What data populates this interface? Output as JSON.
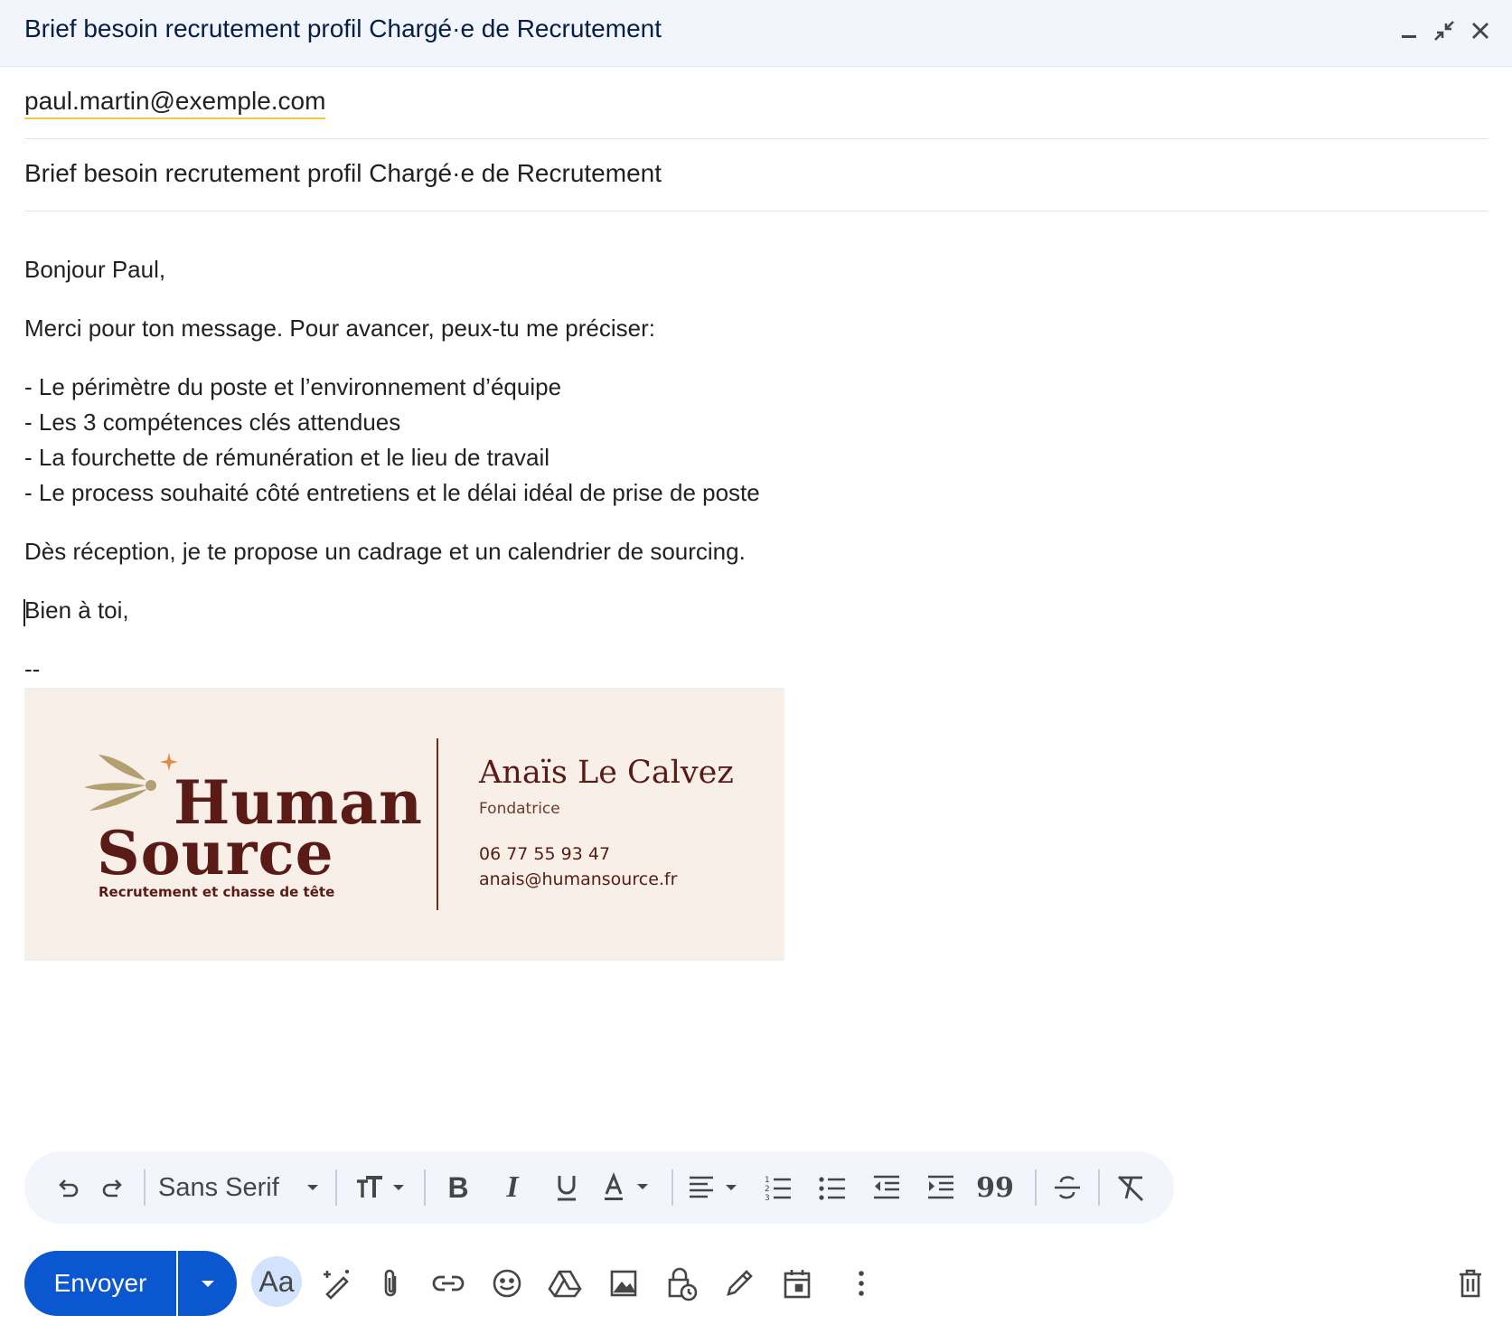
{
  "window": {
    "title": "Brief besoin recrutement profil Chargé·e de Recrutement",
    "icons": [
      "minimize-icon",
      "exit-fullscreen-icon",
      "close-icon"
    ]
  },
  "compose": {
    "to": "paul.martin@exemple.com",
    "subject": "Brief besoin recrutement profil Chargé·e de Recrutement",
    "body": {
      "greeting": "Bonjour Paul,",
      "intro": "Merci pour ton message. Pour avancer, peux-tu me préciser:",
      "bullets": [
        "- Le périmètre du poste et l’environnement d’équipe",
        "- Les 3 compétences clés attendues",
        "- La fourchette de rémunération et le lieu de travail",
        "- Le process souhaité côté entretiens et le délai idéal de prise de poste"
      ],
      "closing_line": "Dès réception, je te propose un cadrage et un calendrier de sourcing.",
      "signoff": "Bien à toi,",
      "sig_separator": "--"
    },
    "signature": {
      "logo_line1": "Human",
      "logo_line2": "Source",
      "tagline": "Recrutement et chasse de tête",
      "name": "Anaïs Le Calvez",
      "role": "Fondatrice",
      "phone": "06 77 55 93 47",
      "email": "anais@humansource.fr"
    }
  },
  "format_toolbar": {
    "font": "Sans Serif",
    "icons": [
      "undo-icon",
      "redo-icon",
      "font-dropdown",
      "text-size-icon",
      "bold-icon",
      "italic-icon",
      "underline-icon",
      "text-color-icon",
      "align-icon",
      "numbered-list-icon",
      "bulleted-list-icon",
      "indent-less-icon",
      "indent-more-icon",
      "quote-icon",
      "strikethrough-icon",
      "remove-formatting-icon"
    ]
  },
  "bottom_toolbar": {
    "send_label": "Envoyer",
    "formatting_label": "Aa",
    "icons": [
      "help-me-write-icon",
      "attach-icon",
      "link-icon",
      "emoji-icon",
      "drive-icon",
      "image-icon",
      "confidential-icon",
      "signature-icon",
      "schedule-icon",
      "more-options-icon",
      "trash-icon"
    ]
  },
  "colors": {
    "primary": "#0b57d0",
    "titlebar_bg": "#f2f6fc",
    "signature_bg": "#f7efe8",
    "brand_maroon": "#5a1a16",
    "brand_accent": "#e08a4a"
  }
}
